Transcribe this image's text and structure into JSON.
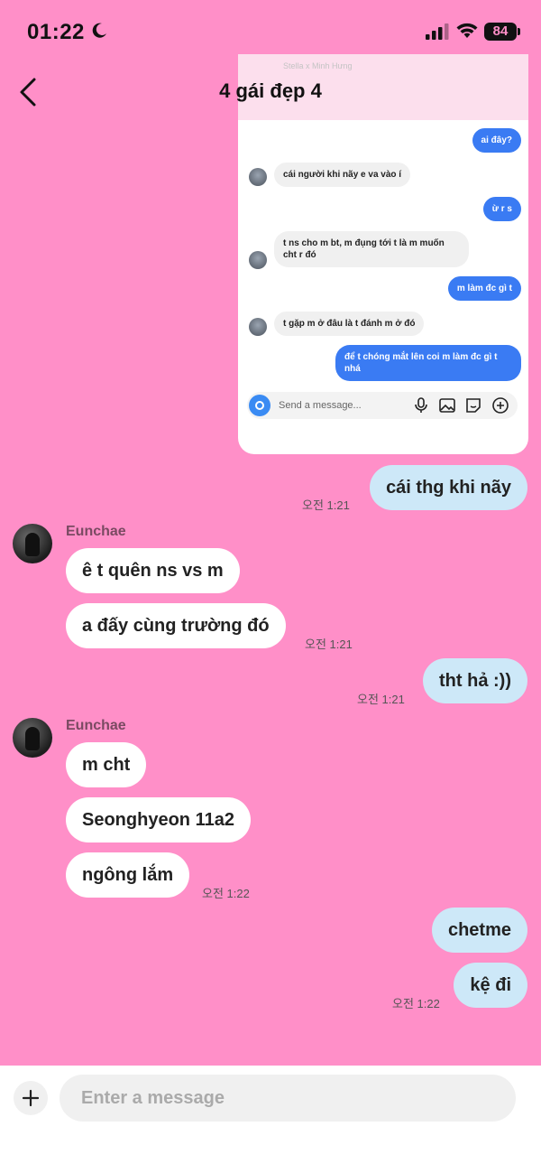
{
  "status": {
    "time": "01:22",
    "battery": "84"
  },
  "header": {
    "title": "4 gái đẹp 4"
  },
  "screenshot": {
    "top_names": "Stella x Minh Hưng",
    "messages": [
      {
        "dir": "out",
        "text": "ai đây?"
      },
      {
        "dir": "in",
        "text": "cái người khi nãy e va vào í"
      },
      {
        "dir": "out",
        "text": "ừ r s"
      },
      {
        "dir": "in",
        "text": "t ns cho m bt, m đụng tới t là m muốn cht r đó"
      },
      {
        "dir": "out",
        "text": "m làm đc gì t"
      },
      {
        "dir": "in",
        "text": "t gặp m ở đâu là t đánh m ở đó"
      },
      {
        "dir": "out",
        "text": "để t chóng mắt lên coi m làm đc gì t nhá"
      }
    ],
    "input_placeholder": "Send a message..."
  },
  "chat": {
    "sender": "Eunchae",
    "m1": {
      "text": "cái thg khi nãy",
      "time": "오전 1:21"
    },
    "m2": {
      "text": "ê t quên ns vs m"
    },
    "m3": {
      "text": "a đấy cùng trường đó",
      "time": "오전 1:21"
    },
    "m4": {
      "text": "tht hả :))",
      "time": "오전 1:21"
    },
    "m5": {
      "text": "m cht"
    },
    "m6": {
      "text": "Seonghyeon 11a2"
    },
    "m7": {
      "text": "ngông lắm",
      "time": "오전 1:22"
    },
    "m8": {
      "text": "chetme"
    },
    "m9": {
      "text": "kệ đi",
      "time": "오전 1:22"
    }
  },
  "composer": {
    "placeholder": "Enter a message"
  },
  "colors": {
    "background": "#ff8fc8",
    "outgoing_bubble": "#cde8f8",
    "incoming_bubble": "#ffffff",
    "screenshot_outgoing": "#3a7bf3"
  }
}
